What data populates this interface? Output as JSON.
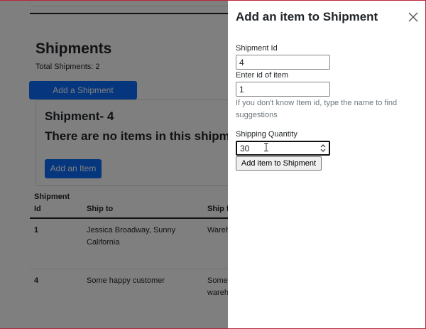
{
  "background": {
    "page_title": "Shipments",
    "total_label": "Total Shipments: ",
    "total_count": "2",
    "add_shipment_label": "Add a Shipment",
    "card": {
      "title": "Shipment- 4",
      "empty_text": "There are no items in this shipm",
      "add_item_label": "Add an Item"
    },
    "table": {
      "headers": [
        "Shipment Id",
        "Ship to",
        "Ship f"
      ],
      "rows": [
        {
          "id": "1",
          "ship_to": "Jessica Broadway, Sunny California",
          "ship_from": "Wareh"
        },
        {
          "id": "4",
          "ship_to": "Some happy customer",
          "ship_from": "Some wareh"
        }
      ]
    }
  },
  "panel": {
    "title": "Add an item to Shipment",
    "close_icon": "close-icon",
    "shipment_id": {
      "label": "Shipment Id",
      "value": "4"
    },
    "item_id": {
      "label": "Enter id of item",
      "value": "1"
    },
    "hint": "If you don't know Item id, type the name to find suggestions",
    "quantity": {
      "label": "Shipping Quantity",
      "value": "30"
    },
    "submit_label": "Add item to Shipment"
  },
  "colors": {
    "primary": "#0d6efd",
    "backdrop": "rgba(0,0,0,0.5)",
    "frame": "#b8263a",
    "hint": "#6c757d"
  }
}
